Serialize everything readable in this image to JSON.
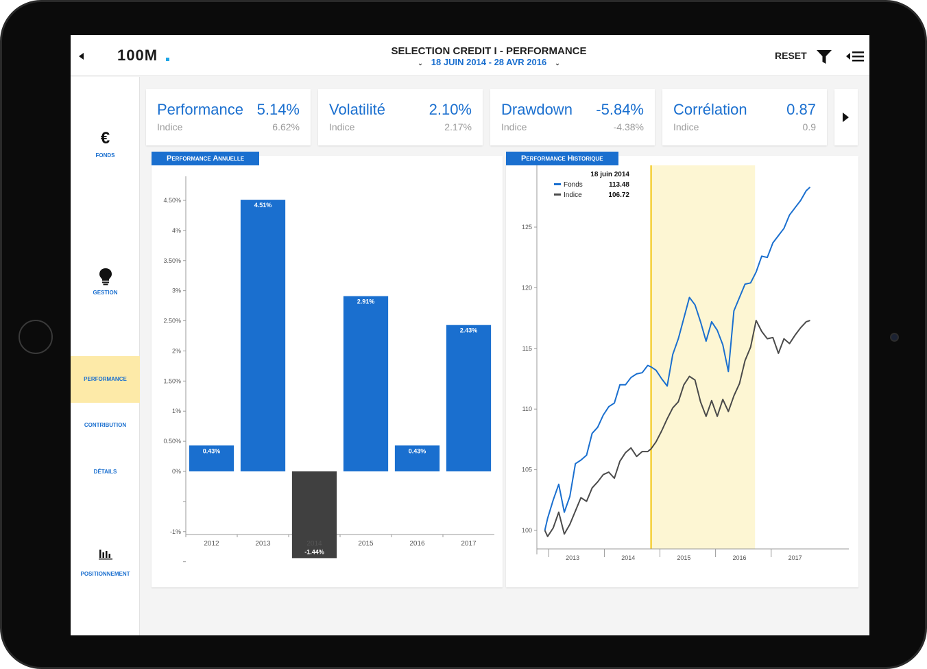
{
  "header": {
    "logo": "100M",
    "title": "SELECTION CREDIT I - PERFORMANCE",
    "date_range": "18 JUIN 2014 - 28 AVR 2016",
    "reset_label": "RESET"
  },
  "sidebar": {
    "items": [
      {
        "label": "FONDS",
        "icon": "euro-icon"
      },
      {
        "label": "GESTION",
        "icon": "lightbulb-icon"
      },
      {
        "label": "PERFORMANCE",
        "active": true
      },
      {
        "label": "CONTRIBUTION"
      },
      {
        "label": "DÉTAILS"
      },
      {
        "label": "POSITIONNEMENT",
        "icon": "bar-chart-icon"
      }
    ]
  },
  "kpis": [
    {
      "name": "Performance",
      "value": "5.14%",
      "sub_label": "Indice",
      "sub_value": "6.62%"
    },
    {
      "name": "Volatilité",
      "value": "2.10%",
      "sub_label": "Indice",
      "sub_value": "2.17%"
    },
    {
      "name": "Drawdown",
      "value": "-5.84%",
      "sub_label": "Indice",
      "sub_value": "-4.38%"
    },
    {
      "name": "Corrélation",
      "value": "0.87",
      "sub_label": "Indice",
      "sub_value": "0.9"
    }
  ],
  "colors": {
    "accent": "#1a6fcf",
    "fund_line": "#1a6fcf",
    "index_line": "#4a4a4a",
    "highlight": "#fdf6d3",
    "marker": "#f2c200",
    "negative_bar": "#404040"
  },
  "chart_data": [
    {
      "type": "bar",
      "title": "Performance Annuelle",
      "categories": [
        "2012",
        "2013",
        "2014",
        "2015",
        "2016",
        "2017"
      ],
      "values": [
        0.43,
        4.51,
        -1.44,
        2.91,
        0.43,
        2.43
      ],
      "value_labels": [
        "0.43%",
        "4.51%",
        "-1.44%",
        "2.91%",
        "0.43%",
        "2.43%"
      ],
      "y_ticks": [
        4.5,
        4,
        3.5,
        3,
        2.5,
        2,
        1.5,
        1,
        0.5,
        0,
        -0.5,
        -1,
        -1.5
      ],
      "y_tick_labels": [
        "4.50%",
        "4%",
        "3.50%",
        "3%",
        "2.50%",
        "2%",
        "1.50%",
        "1%",
        "0.50%",
        "0%",
        "",
        "-1%",
        ""
      ],
      "ylim": [
        -1.9,
        5.1
      ]
    },
    {
      "type": "line",
      "title": "Performance Historique",
      "x_ticks": [
        "2013",
        "2014",
        "2015",
        "2016",
        "2017"
      ],
      "y_ticks": [
        100,
        105,
        110,
        115,
        120,
        125
      ],
      "ylim": [
        95,
        131
      ],
      "tooltip": {
        "date": "18 juin 2014",
        "rows": [
          {
            "label": "Fonds",
            "value": "113.48"
          },
          {
            "label": "Indice",
            "value": "106.72"
          }
        ]
      },
      "highlight_range": [
        "18 juin 2014",
        "28 avr 2016"
      ],
      "series": [
        {
          "name": "Fonds",
          "x": [
            2012.55,
            2012.6,
            2012.7,
            2012.8,
            2012.9,
            2013.0,
            2013.1,
            2013.2,
            2013.3,
            2013.4,
            2013.5,
            2013.6,
            2013.7,
            2013.8,
            2013.9,
            2014.0,
            2014.1,
            2014.2,
            2014.3,
            2014.4,
            2014.46,
            2014.55,
            2014.65,
            2014.75,
            2014.85,
            2014.95,
            2015.05,
            2015.15,
            2015.25,
            2015.35,
            2015.45,
            2015.55,
            2015.65,
            2015.75,
            2015.85,
            2015.95,
            2016.05,
            2016.15,
            2016.25,
            2016.35,
            2016.45,
            2016.55,
            2016.65,
            2016.75,
            2016.85,
            2016.95,
            2017.05,
            2017.15,
            2017.25,
            2017.32
          ],
          "values": [
            100,
            101,
            102.5,
            103.8,
            101.5,
            102.8,
            105.5,
            105.8,
            106.2,
            108,
            108.5,
            109.5,
            110.2,
            110.5,
            112,
            112,
            112.6,
            112.9,
            113,
            113.6,
            113.48,
            113.2,
            112.5,
            111.9,
            114.5,
            115.8,
            117.5,
            119.2,
            118.6,
            117.2,
            115.6,
            117.2,
            116.5,
            115.3,
            113.1,
            118.1,
            119.2,
            120.3,
            120.4,
            121.3,
            122.6,
            122.5,
            123.7,
            124.3,
            124.9,
            126,
            126.6,
            127.2,
            128,
            128.3
          ]
        },
        {
          "name": "Indice",
          "x": [
            2012.55,
            2012.6,
            2012.7,
            2012.8,
            2012.9,
            2013.0,
            2013.1,
            2013.2,
            2013.3,
            2013.4,
            2013.5,
            2013.6,
            2013.7,
            2013.8,
            2013.9,
            2014.0,
            2014.1,
            2014.2,
            2014.3,
            2014.4,
            2014.46,
            2014.55,
            2014.65,
            2014.75,
            2014.85,
            2014.95,
            2015.05,
            2015.15,
            2015.25,
            2015.35,
            2015.45,
            2015.55,
            2015.65,
            2015.75,
            2015.85,
            2015.95,
            2016.05,
            2016.15,
            2016.25,
            2016.35,
            2016.45,
            2016.55,
            2016.65,
            2016.75,
            2016.85,
            2016.95,
            2017.05,
            2017.15,
            2017.25,
            2017.32
          ],
          "values": [
            100,
            99.5,
            100.2,
            101.5,
            99.7,
            100.5,
            101.6,
            102.7,
            102.4,
            103.5,
            104,
            104.6,
            104.8,
            104.3,
            105.7,
            106.4,
            106.8,
            106.1,
            106.5,
            106.5,
            106.72,
            107.3,
            108.2,
            109.2,
            110.1,
            110.6,
            112,
            112.7,
            112.4,
            110.6,
            109.4,
            110.7,
            109.4,
            110.8,
            109.8,
            111.1,
            112.1,
            114,
            115.1,
            117.3,
            116.4,
            115.8,
            115.9,
            114.6,
            115.8,
            115.4,
            116.1,
            116.7,
            117.2,
            117.3
          ]
        }
      ]
    }
  ]
}
